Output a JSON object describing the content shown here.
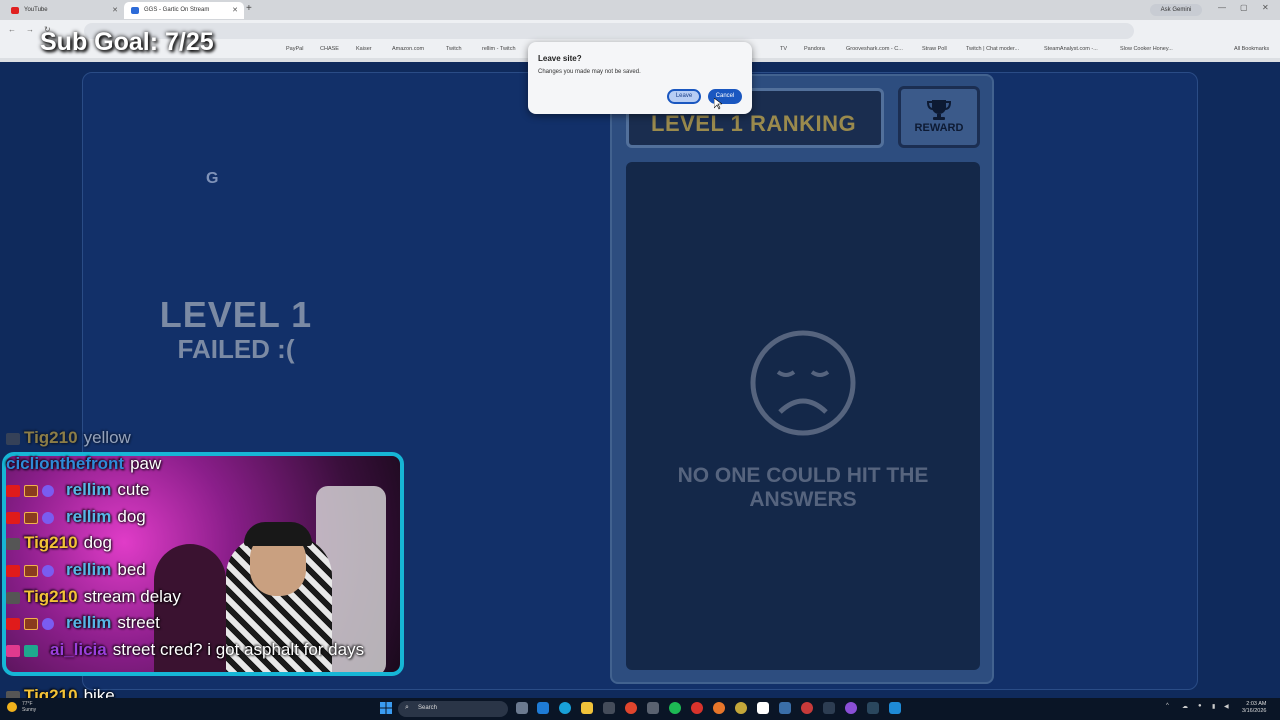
{
  "browser": {
    "tabs": [
      {
        "title": "YouTube",
        "favicon_color": "#e02020",
        "active": false
      },
      {
        "title": "GGS - Gartic On Stream",
        "favicon_color": "#2d6bd8",
        "active": true
      }
    ],
    "ask_gemini": "Ask Gemini",
    "bookmarks": [
      "PayPal",
      "CHASE",
      "Kaiser",
      "Amazon.com",
      "Twitch",
      "rellim - Twitch",
      "TV",
      "Pandora",
      "Grooveshark.com - C...",
      "Straw Poll",
      "Twitch | Chat moder...",
      "SteamAnalyst.com -...",
      "Slow Cooker Honey...",
      "All Bookmarks"
    ]
  },
  "overlay": {
    "sub_goal": "Sub Goal: 7/25"
  },
  "game": {
    "hint_letter": "G",
    "level_label": "LEVEL 1",
    "failed_label": "FAILED :(",
    "ranking_title": "LEVEL 1 RANKING",
    "reward_label": "REWARD",
    "empty_message": "NO ONE COULD HIT THE ANSWERS"
  },
  "dialog": {
    "title": "Leave site?",
    "message": "Changes you made may not be saved.",
    "leave_label": "Leave",
    "cancel_label": "Cancel"
  },
  "chat": {
    "messages": [
      {
        "user": "Tig210",
        "text": "yellow",
        "user_color": "#f3c237",
        "badges": [
          "mod"
        ]
      },
      {
        "user": "ciclionthefront",
        "text": "paw",
        "user_color": "#2f8ad8",
        "badges": []
      },
      {
        "user": "rellim",
        "text": "cute",
        "user_color": "#57b6e6",
        "badges": [
          "red",
          "sub",
          "check"
        ]
      },
      {
        "user": "rellim",
        "text": "dog",
        "user_color": "#57b6e6",
        "badges": [
          "red",
          "sub",
          "check"
        ]
      },
      {
        "user": "Tig210",
        "text": "dog",
        "user_color": "#f3c237",
        "badges": [
          "mod"
        ]
      },
      {
        "user": "rellim",
        "text": "bed",
        "user_color": "#57b6e6",
        "badges": [
          "red",
          "sub",
          "check"
        ]
      },
      {
        "user": "Tig210",
        "text": "stream delay",
        "user_color": "#f3c237",
        "badges": [
          "mod"
        ]
      },
      {
        "user": "rellim",
        "text": "street",
        "user_color": "#57b6e6",
        "badges": [
          "red",
          "sub",
          "check"
        ]
      },
      {
        "user": "ai_licia",
        "text": "street cred? i got asphalt for days",
        "user_color": "#9b3fdc",
        "badges": [
          "pink",
          "teal"
        ]
      },
      {
        "user": "Tig210",
        "text": "bike",
        "user_color": "#f3c237",
        "badges": [
          "mod"
        ]
      }
    ]
  },
  "taskbar": {
    "weather_temp": "77°F",
    "weather_desc": "Sunny",
    "search_label": "Search",
    "time": "2:03 AM",
    "date": "3/16/2026"
  },
  "colors": {
    "accent": "#1a57c0",
    "webcam_border": "#16b6d6",
    "ranking_title": "#9a8a4d"
  }
}
